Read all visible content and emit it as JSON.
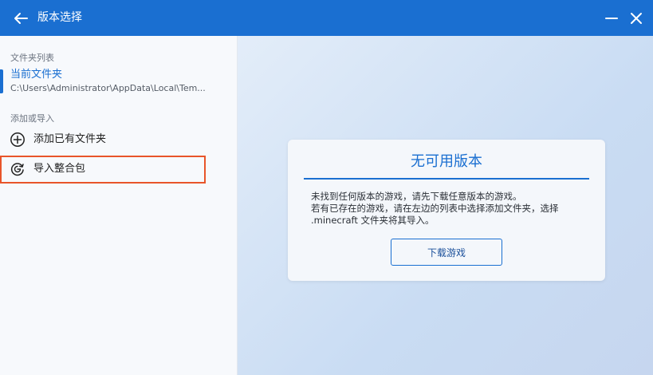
{
  "window": {
    "title": "版本选择",
    "back_icon": "back-arrow-icon",
    "minimize_icon": "minimize-icon",
    "close_icon": "close-icon"
  },
  "sidebar": {
    "folder_list_label": "文件夹列表",
    "current_folder": {
      "name": "当前文件夹",
      "path": "C:\\Users\\Administrator\\AppData\\Local\\Tem..."
    },
    "add_import_label": "添加或导入",
    "items": [
      {
        "label": "添加已有文件夹",
        "icon": "add-circle-icon"
      },
      {
        "label": "导入整合包",
        "icon": "import-package-icon"
      }
    ]
  },
  "main": {
    "card": {
      "title": "无可用版本",
      "message": "未找到任何版本的游戏，请先下载任意版本的游戏。\n若有已存在的游戏，请在左边的列表中选择添加文件夹，选择 .minecraft 文件夹将其导入。",
      "button_label": "下载游戏"
    }
  },
  "colors": {
    "accent": "#1a6fd1",
    "highlight": "#e8552a"
  }
}
